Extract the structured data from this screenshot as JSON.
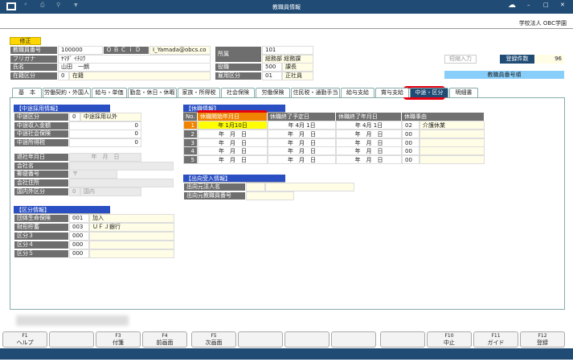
{
  "window": {
    "title": "教職員情報",
    "company": "学校法人 OBC学園",
    "toolbar_icons": [
      "window-icon",
      "search-icon",
      "print-icon",
      "tools-icon",
      "dropdown-icon"
    ],
    "controls": [
      "minimize",
      "maximize",
      "close"
    ]
  },
  "mode_badge": "修正",
  "header": {
    "employee_no_label": "教職員番号",
    "employee_no": "100000",
    "obcid_label": "ＯＢＣｉＤ",
    "obcid": "I_Yamada@obcs.co",
    "furigana_label": "フリガナ",
    "furigana": "ﾔﾏﾀﾞ ｲﾁﾛｳ",
    "name_label": "氏名",
    "name": "山田　一朗",
    "status_label": "在籍区分",
    "status_code": "0",
    "status": "在籍",
    "dept_label": "所属",
    "dept_code": "101",
    "dept": "総務部 総務課",
    "position_label": "役職",
    "position_code": "500",
    "position": "課長",
    "employment_label": "雇用区分",
    "employment_code": "01",
    "employment": "正社員",
    "shortcut_button": "短縮入力",
    "count_label": "登録件数",
    "count": "96",
    "sort_label": "教職員番号順"
  },
  "tabs": [
    "基　本",
    "労働契約・外国人",
    "給与・単価",
    "勤怠・休日・休暇",
    "家族・所得税",
    "社会保険",
    "労働保険",
    "住民税・通勤手当",
    "給与支給",
    "賞与支給",
    "中途・区分",
    "明細書"
  ],
  "active_tab": "中途・区分",
  "midcareer": {
    "title": "【中途採用情報】",
    "rows": [
      {
        "label": "中途区分",
        "code": "0",
        "value": "中途採用以外"
      },
      {
        "label": "中途収入金額",
        "value": "0"
      },
      {
        "label": "中途社会保険",
        "value": "0"
      },
      {
        "label": "中途所得税",
        "value": "0"
      }
    ]
  },
  "previous_company": {
    "rows": [
      {
        "label": "退社年月日",
        "value": "年　月　日"
      },
      {
        "label": "会社名",
        "value": ""
      },
      {
        "label": "郵便番号",
        "value": "〒"
      },
      {
        "label": "会社住所",
        "value": ""
      },
      {
        "label": "国内外区分",
        "code": "0",
        "value": "国内"
      }
    ]
  },
  "category": {
    "title": "【区分情報】",
    "rows": [
      {
        "label": "団体生命保険",
        "code": "001",
        "value": "加入"
      },
      {
        "label": "財形貯蓄",
        "code": "003",
        "value": "ＵＦＪ銀行"
      },
      {
        "label": "区分３",
        "code": "000",
        "value": ""
      },
      {
        "label": "区分４",
        "code": "000",
        "value": ""
      },
      {
        "label": "区分５",
        "code": "000",
        "value": ""
      }
    ]
  },
  "leave": {
    "title": "【休職情報】",
    "columns": [
      "No.",
      "休職開始年月日",
      "休職終了予定日",
      "休職終了年月日",
      "休職事由"
    ],
    "rows": [
      {
        "no": "1",
        "start": "年  1月10日",
        "planned_end": "年  4月  1日",
        "end": "年  4月  1日",
        "code": "02",
        "reason": "介護休業"
      },
      {
        "no": "2",
        "start": "年　月　日",
        "planned_end": "年　月　日",
        "end": "年　月　日",
        "code": "00",
        "reason": ""
      },
      {
        "no": "3",
        "start": "年　月　日",
        "planned_end": "年　月　日",
        "end": "年　月　日",
        "code": "00",
        "reason": ""
      },
      {
        "no": "4",
        "start": "年　月　日",
        "planned_end": "年　月　日",
        "end": "年　月　日",
        "code": "00",
        "reason": ""
      },
      {
        "no": "5",
        "start": "年　月　日",
        "planned_end": "年　月　日",
        "end": "年　月　日",
        "code": "00",
        "reason": ""
      }
    ]
  },
  "secondment": {
    "title": "【出向受入情報】",
    "rows": [
      {
        "label": "出向元法人名"
      },
      {
        "label": "出向元教職員番号"
      }
    ]
  },
  "function_keys": [
    {
      "key": "F1",
      "label": "ヘルプ"
    },
    {
      "key": "",
      "label": ""
    },
    {
      "key": "F3",
      "label": "付箋"
    },
    {
      "key": "F4",
      "label": "前画面"
    },
    {
      "key": "F5",
      "label": "次画面"
    },
    {
      "key": "",
      "label": ""
    },
    {
      "key": "",
      "label": ""
    },
    {
      "key": "",
      "label": ""
    },
    {
      "key": "",
      "label": ""
    },
    {
      "key": "F10",
      "label": "中止"
    },
    {
      "key": "F11",
      "label": "ガイド"
    },
    {
      "key": "F12",
      "label": "登録"
    }
  ],
  "colors": {
    "titlebar": "#1f4b75",
    "label_bg": "#6e6e6e",
    "section": "#2a4fc2",
    "highlight": "#e60012",
    "active_col": "#f08300",
    "input_focus": "#ffff00"
  }
}
